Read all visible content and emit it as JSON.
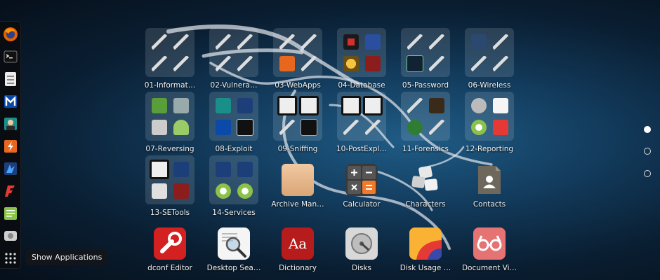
{
  "dock": {
    "items": [
      {
        "name": "firefox-icon"
      },
      {
        "name": "terminal-icon"
      },
      {
        "name": "files-icon"
      },
      {
        "name": "metasploit-icon"
      },
      {
        "name": "armitage-icon"
      },
      {
        "name": "burpsuite-icon"
      },
      {
        "name": "beef-icon"
      },
      {
        "name": "faraday-icon"
      },
      {
        "name": "leafpad-icon"
      },
      {
        "name": "cutycapt-icon"
      }
    ],
    "show_apps_tooltip": "Show Applications"
  },
  "apps": [
    {
      "label": "01-Informat…",
      "kind": "folder"
    },
    {
      "label": "02-Vulnera…",
      "kind": "folder"
    },
    {
      "label": "03-WebApps",
      "kind": "folder"
    },
    {
      "label": "04-Database",
      "kind": "folder"
    },
    {
      "label": "05-Password",
      "kind": "folder"
    },
    {
      "label": "06-Wireless",
      "kind": "folder"
    },
    {
      "label": "07-Reversing",
      "kind": "folder"
    },
    {
      "label": "08-Exploit",
      "kind": "folder"
    },
    {
      "label": "09-Sniffing",
      "kind": "folder"
    },
    {
      "label": "10-PostExpl…",
      "kind": "folder"
    },
    {
      "label": "11-Forensics",
      "kind": "folder"
    },
    {
      "label": "12-Reporting",
      "kind": "folder"
    },
    {
      "label": "13-SETools",
      "kind": "folder"
    },
    {
      "label": "14-Services",
      "kind": "folder"
    },
    {
      "label": "Archive Man…",
      "kind": "app",
      "icon": "archive-manager-icon"
    },
    {
      "label": "Calculator",
      "kind": "app",
      "icon": "calculator-icon"
    },
    {
      "label": "Characters",
      "kind": "app",
      "icon": "characters-icon"
    },
    {
      "label": "Contacts",
      "kind": "app",
      "icon": "contacts-icon"
    },
    {
      "label": "dconf Editor",
      "kind": "app",
      "icon": "dconf-editor-icon"
    },
    {
      "label": "Desktop Sea…",
      "kind": "app",
      "icon": "desktop-search-icon"
    },
    {
      "label": "Dictionary",
      "kind": "app",
      "icon": "dictionary-icon"
    },
    {
      "label": "Disks",
      "kind": "app",
      "icon": "disks-icon"
    },
    {
      "label": "Disk Usage …",
      "kind": "app",
      "icon": "disk-usage-icon"
    },
    {
      "label": "Document Vi…",
      "kind": "app",
      "icon": "document-viewer-icon"
    }
  ],
  "icon_text": {
    "dictionary": "Aa"
  },
  "pages": {
    "count": 3,
    "active": 1
  },
  "colors": {
    "accent_red": "#c62828",
    "calculator_orange": "#f07a2b",
    "bg_center": "#1f5c86"
  }
}
